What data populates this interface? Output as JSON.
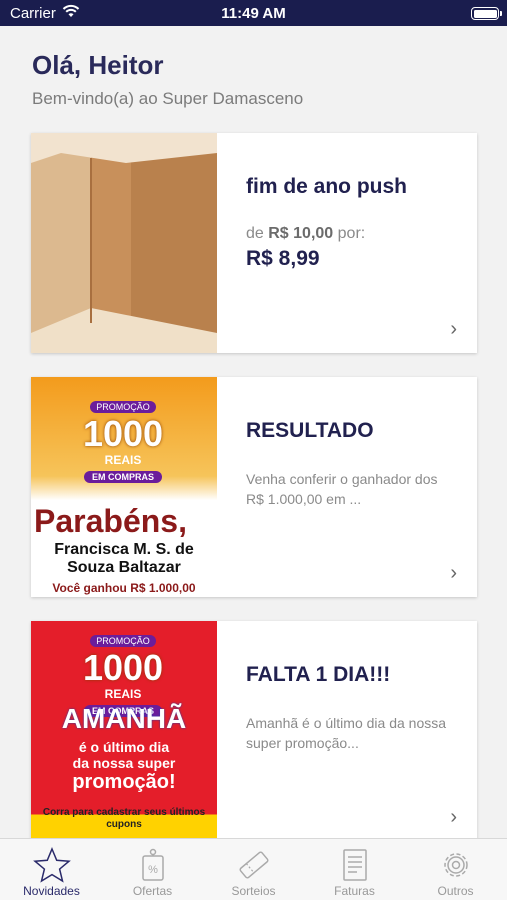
{
  "status": {
    "carrier": "Carrier",
    "time": "11:49 AM"
  },
  "header": {
    "greeting": "Olá, Heitor",
    "subtitle": "Bem-vindo(a) ao Super Damasceno"
  },
  "cards": [
    {
      "title": "fim de ano push",
      "price_prefix": "de",
      "old_price": "R$ 10,00",
      "price_suffix": "por:",
      "new_price": "R$ 8,99"
    },
    {
      "title": "RESULTADO",
      "description": "Venha conferir o ganhador dos R$ 1.000,00 em ...",
      "image_text": {
        "promo": "PROMOÇÃO",
        "amount": "1000",
        "reais": "REAIS",
        "compras": "EM COMPRAS",
        "headline": "Parabéns,",
        "name": "Francisca M. S. de Souza Baltazar",
        "won": "Você ganhou R$ 1.000,00"
      }
    },
    {
      "title": "FALTA 1 DIA!!!",
      "description": "Amanhã é o último dia da nossa super promoção...",
      "image_text": {
        "promo": "PROMOÇÃO",
        "amount": "1000",
        "reais": "REAIS",
        "compras": "EM COMPRAS",
        "headline": "AMANHÃ",
        "line1": "é o último dia",
        "line2": "da nossa super",
        "line3": "promoção!",
        "cta": "Corra para cadastrar seus últimos cupons"
      }
    }
  ],
  "tabs": [
    {
      "label": "Novidades",
      "icon": "star-icon",
      "active": true
    },
    {
      "label": "Ofertas",
      "icon": "offer-tag-icon",
      "active": false
    },
    {
      "label": "Sorteios",
      "icon": "ticket-icon",
      "active": false
    },
    {
      "label": "Faturas",
      "icon": "invoice-icon",
      "active": false
    },
    {
      "label": "Outros",
      "icon": "gear-icon",
      "active": false
    }
  ],
  "colors": {
    "status_bar": "#1a1d4e",
    "title_text": "#21214f",
    "active_tab": "#2a2a6a",
    "promo_orange": "#f39b1c",
    "promo_red": "#e41e2a",
    "promo_maroon": "#8b1a1a"
  }
}
